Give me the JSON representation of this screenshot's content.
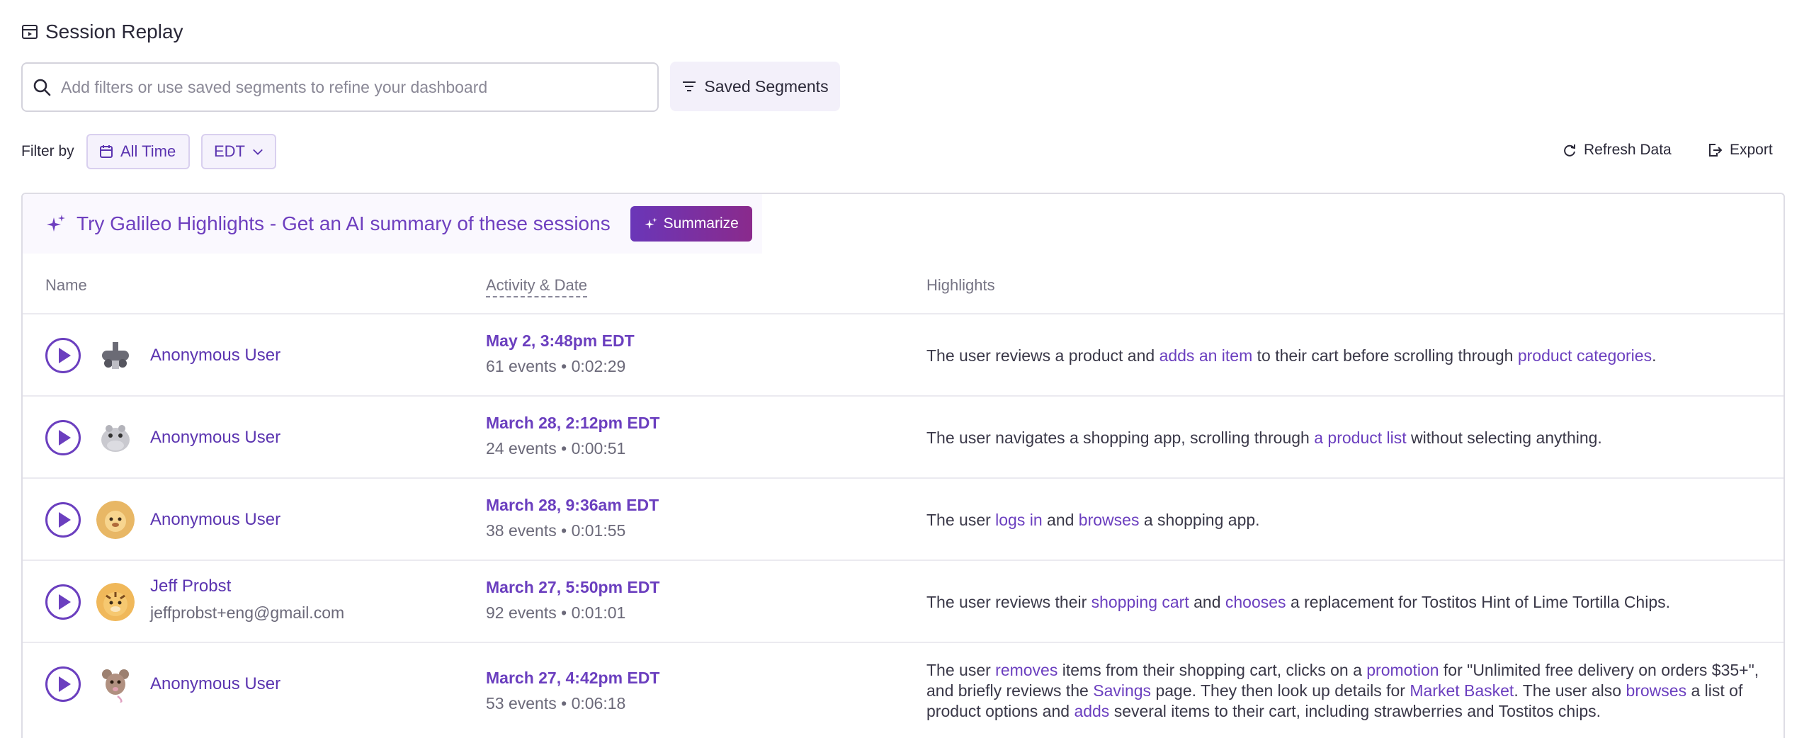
{
  "header": {
    "title": "Session Replay"
  },
  "search": {
    "placeholder": "Add filters or use saved segments to refine your dashboard"
  },
  "saved_segments": {
    "label": "Saved Segments"
  },
  "filter": {
    "label": "Filter by",
    "time_label": "All Time",
    "timezone_label": "EDT"
  },
  "actions": {
    "refresh": "Refresh Data",
    "export": "Export"
  },
  "banner": {
    "text": "Try Galileo Highlights - Get an AI summary of these sessions",
    "button": "Summarize"
  },
  "columns": {
    "name": "Name",
    "activity": "Activity & Date",
    "highlights": "Highlights"
  },
  "sessions": [
    {
      "name": "Anonymous User",
      "email": "",
      "date": "May 2, 3:48pm EDT",
      "meta": "61 events • 0:02:29",
      "avatar": "robot-avatar",
      "highlight": [
        {
          "t": "The user reviews a product and ",
          "link": false
        },
        {
          "t": "adds an item",
          "link": true
        },
        {
          "t": " to their cart before scrolling through ",
          "link": false
        },
        {
          "t": "product categories",
          "link": true
        },
        {
          "t": ".",
          "link": false
        }
      ]
    },
    {
      "name": "Anonymous User",
      "email": "",
      "date": "March 28, 2:12pm EDT",
      "meta": "24 events • 0:00:51",
      "avatar": "hippo-avatar",
      "highlight": [
        {
          "t": "The user navigates a shopping app, scrolling through ",
          "link": false
        },
        {
          "t": "a product list",
          "link": true
        },
        {
          "t": " without selecting anything.",
          "link": false
        }
      ]
    },
    {
      "name": "Anonymous User",
      "email": "",
      "date": "March 28, 9:36am EDT",
      "meta": "38 events • 0:01:55",
      "avatar": "lion-avatar",
      "highlight": [
        {
          "t": "The user ",
          "link": false
        },
        {
          "t": "logs in",
          "link": true
        },
        {
          "t": " and ",
          "link": false
        },
        {
          "t": "browses",
          "link": true
        },
        {
          "t": " a shopping app.",
          "link": false
        }
      ]
    },
    {
      "name": "Jeff Probst",
      "email": "jeffprobst+eng@gmail.com",
      "date": "March 27, 5:50pm EDT",
      "meta": "92 events • 0:01:01",
      "avatar": "tiger-avatar",
      "highlight": [
        {
          "t": "The user reviews their ",
          "link": false
        },
        {
          "t": "shopping cart",
          "link": true
        },
        {
          "t": " and ",
          "link": false
        },
        {
          "t": "chooses",
          "link": true
        },
        {
          "t": " a replacement for Tostitos Hint of Lime Tortilla Chips.",
          "link": false
        }
      ]
    },
    {
      "name": "Anonymous User",
      "email": "",
      "date": "March 27, 4:42pm EDT",
      "meta": "53 events • 0:06:18",
      "avatar": "rat-avatar",
      "highlight": [
        {
          "t": "The user ",
          "link": false
        },
        {
          "t": "removes",
          "link": true
        },
        {
          "t": " items from their shopping cart, clicks on a ",
          "link": false
        },
        {
          "t": "promotion",
          "link": true
        },
        {
          "t": " for \"Unlimited free delivery on orders $35+\", and briefly reviews the ",
          "link": false
        },
        {
          "t": "Savings",
          "link": true
        },
        {
          "t": " page. They then look up details for ",
          "link": false
        },
        {
          "t": "Market Basket",
          "link": true
        },
        {
          "t": ". The user also ",
          "link": false
        },
        {
          "t": "browses",
          "link": true
        },
        {
          "t": " a list of product options and ",
          "link": false
        },
        {
          "t": "adds",
          "link": true
        },
        {
          "t": " several items to their cart, including strawberries and Tostitos chips.",
          "link": false
        }
      ]
    }
  ]
}
